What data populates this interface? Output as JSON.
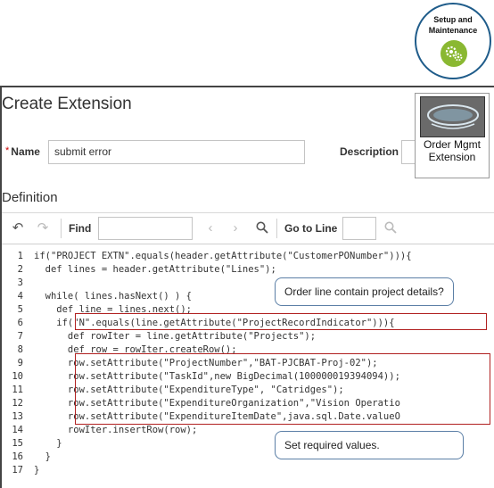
{
  "badge": {
    "line1": "Setup and",
    "line2": "Maintenance",
    "icon": "gears-icon",
    "accent": "#8ab832",
    "ring": "#1f5c8a"
  },
  "page": {
    "title": "Create Extension"
  },
  "form": {
    "name_label": "Name",
    "name_value": "submit error",
    "description_label": "Description",
    "required_marker": "*"
  },
  "extension_badge": {
    "caption1": "Order Mgmt",
    "caption2": "Extension",
    "logo_icon": "groovy-logo-icon"
  },
  "definition": {
    "label": "Definition"
  },
  "toolbar": {
    "find_label": "Find",
    "goto_label": "Go to Line",
    "find_value": "",
    "goto_value": ""
  },
  "code": {
    "lines": [
      {
        "n": "1",
        "text": "if(\"PROJECT EXTN\".equals(header.getAttribute(\"CustomerPONumber\"))){"
      },
      {
        "n": "2",
        "text": "  def lines = header.getAttribute(\"Lines\");"
      },
      {
        "n": "3",
        "text": ""
      },
      {
        "n": "4",
        "text": "  while( lines.hasNext() ) {"
      },
      {
        "n": "5",
        "text": "    def line = lines.next();"
      },
      {
        "n": "6",
        "text": "    if(\"N\".equals(line.getAttribute(\"ProjectRecordIndicator\"))){"
      },
      {
        "n": "7",
        "text": "      def rowIter = line.getAttribute(\"Projects\");"
      },
      {
        "n": "8",
        "text": "      def row = rowIter.createRow();"
      },
      {
        "n": "9",
        "text": "      row.setAttribute(\"ProjectNumber\",\"BAT-PJCBAT-Proj-02\");"
      },
      {
        "n": "10",
        "text": "      row.setAttribute(\"TaskId\",new BigDecimal(100000019394094));"
      },
      {
        "n": "11",
        "text": "      row.setAttribute(\"ExpenditureType\", \"Catridges\");"
      },
      {
        "n": "12",
        "text": "      row.setAttribute(\"ExpenditureOrganization\",\"Vision Operatio"
      },
      {
        "n": "13",
        "text": "      row.setAttribute(\"ExpenditureItemDate\",java.sql.Date.valueO"
      },
      {
        "n": "14",
        "text": "      rowIter.insertRow(row);"
      },
      {
        "n": "15",
        "text": "    }"
      },
      {
        "n": "16",
        "text": "  }"
      },
      {
        "n": "17",
        "text": "}"
      }
    ]
  },
  "callouts": {
    "project_details": "Order line contain project details?",
    "required_values": "Set required values."
  }
}
